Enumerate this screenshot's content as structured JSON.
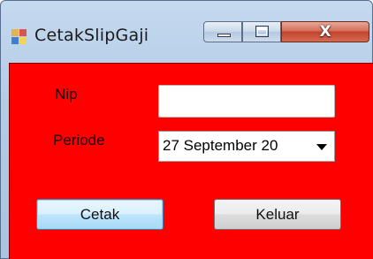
{
  "window": {
    "title": "CetakSlipGaji",
    "caption_buttons": {
      "minimize_icon": "minimize-icon",
      "maximize_icon": "maximize-icon",
      "close_glyph": "X"
    }
  },
  "form": {
    "background_color": "#ff0000",
    "nip_label": "Nip",
    "nip_value": "",
    "periode_label": "Periode",
    "periode_value": "27 September 20",
    "cetak_button": "Cetak",
    "keluar_button": "Keluar"
  }
}
